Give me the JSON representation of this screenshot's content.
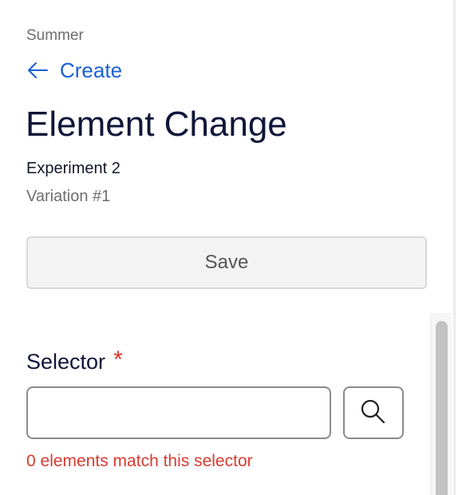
{
  "header": {
    "project": "Summer",
    "back_label": "Create",
    "title": "Element Change",
    "experiment": "Experiment 2",
    "variation": "Variation #1"
  },
  "actions": {
    "save_label": "Save"
  },
  "selector": {
    "label": "Selector",
    "required_mark": "*",
    "value": "",
    "placeholder": "",
    "error": "0 elements match this selector"
  },
  "icons": {
    "back": "arrow-left-icon",
    "search": "search-icon"
  },
  "colors": {
    "link": "#1a5fd6",
    "title": "#0f1638",
    "error": "#d93b30",
    "required": "#e0302b"
  }
}
